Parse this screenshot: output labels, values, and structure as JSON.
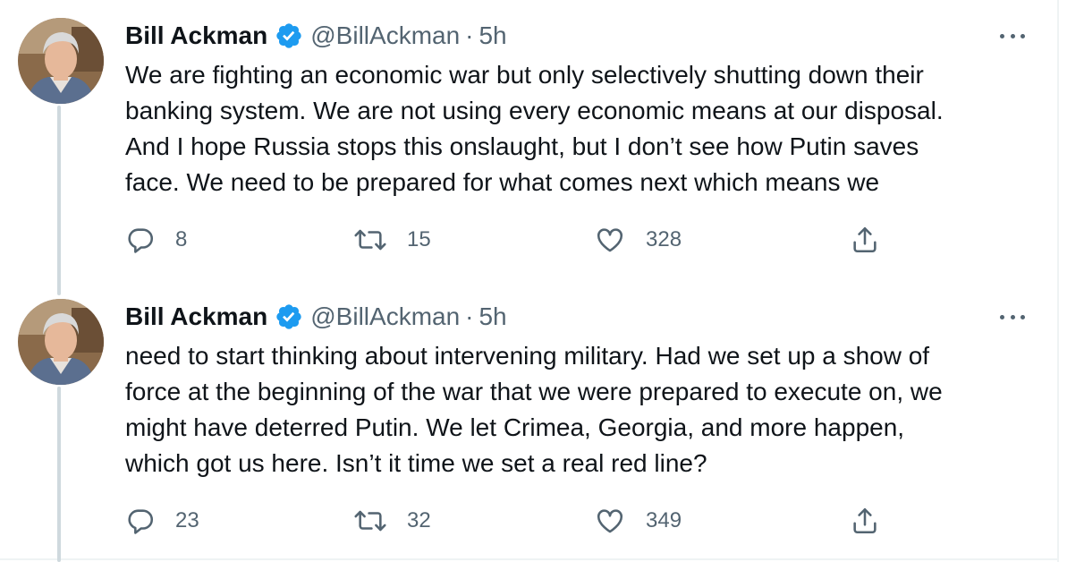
{
  "tweets": [
    {
      "author": {
        "name": "Bill Ackman",
        "handle": "@BillAckman",
        "separator": "·",
        "time": "5h"
      },
      "text_lines": [
        "We are fighting an economic war but only selectively shutting down their",
        "banking system. We are not using every economic means at our disposal.",
        "And I hope Russia stops this onslaught, but I don’t see how Putin saves",
        "face. We need to be prepared for what comes next which means we"
      ],
      "stats": {
        "replies": "8",
        "retweets": "15",
        "likes": "328"
      }
    },
    {
      "author": {
        "name": "Bill Ackman",
        "handle": "@BillAckman",
        "separator": "·",
        "time": "5h"
      },
      "text_lines": [
        "need to start thinking about intervening military. Had we set up a show of",
        "force at the beginning of the war that we were prepared to execute on, we",
        "might have deterred Putin. We let Crimea, Georgia, and more happen,",
        "which got us here. Isn’t it time we set a real red line?"
      ],
      "stats": {
        "replies": "23",
        "retweets": "32",
        "likes": "349"
      }
    }
  ],
  "icons": {
    "verified": "verified-badge-icon",
    "more": "more-options-icon",
    "reply": "reply-icon",
    "retweet": "retweet-icon",
    "like": "like-icon",
    "share": "share-icon"
  },
  "colors": {
    "text_primary": "#0f1419",
    "text_secondary": "#536471",
    "verified_blue": "#1d9bf0",
    "thread_line": "#cfd9de"
  }
}
